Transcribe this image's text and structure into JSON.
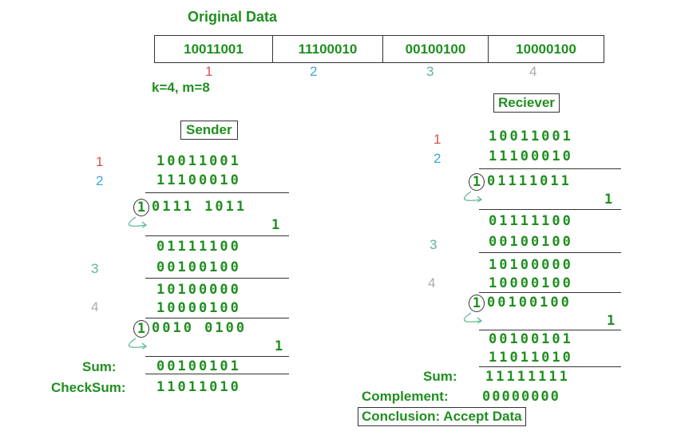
{
  "original": {
    "title": "Original Data",
    "segments": [
      "10011001",
      "11100010",
      "00100100",
      "10000100"
    ],
    "indices": [
      "1",
      "2",
      "3",
      "4"
    ],
    "params": "k=4, m=8"
  },
  "colors": {
    "green": "#1f8f1f",
    "red": "#d9534f",
    "blue": "#3aa8d8",
    "teal": "#5cb890",
    "gray": "#aaaaaa"
  },
  "sender": {
    "title": "Sender",
    "rows": {
      "r1": "10011001",
      "r2": "11100010",
      "r3": "0111 1011",
      "r4": "1",
      "r5": "01111100",
      "r6": "00100100",
      "r7": "10100000",
      "r8": "10000100",
      "r9": "0010 0100",
      "r10": "1",
      "r11": "00100101",
      "r12": "11011010"
    },
    "labels": {
      "l1": "1",
      "l2": "2",
      "l3": "3",
      "l4": "4"
    },
    "carry1": "1",
    "carry2": "1",
    "sum_label": "Sum:",
    "checksum_label": "CheckSum:"
  },
  "receiver": {
    "title": "Reciever",
    "rows": {
      "r1": "10011001",
      "r2": "11100010",
      "r3": "01111011",
      "r4": "1",
      "r5": "01111100",
      "r6": "00100100",
      "r7": "10100000",
      "r8": "10000100",
      "r9": "00100100",
      "r10": "1",
      "r11": "00100101",
      "r12": "11011010",
      "r13": "11111111",
      "r14": "00000000"
    },
    "labels": {
      "l1": "1",
      "l2": "2",
      "l3": "3",
      "l4": "4"
    },
    "carry1": "1",
    "carry2": "1",
    "sum_label": "Sum:",
    "complement_label": "Complement:",
    "conclusion": "Conclusion: Accept Data"
  }
}
